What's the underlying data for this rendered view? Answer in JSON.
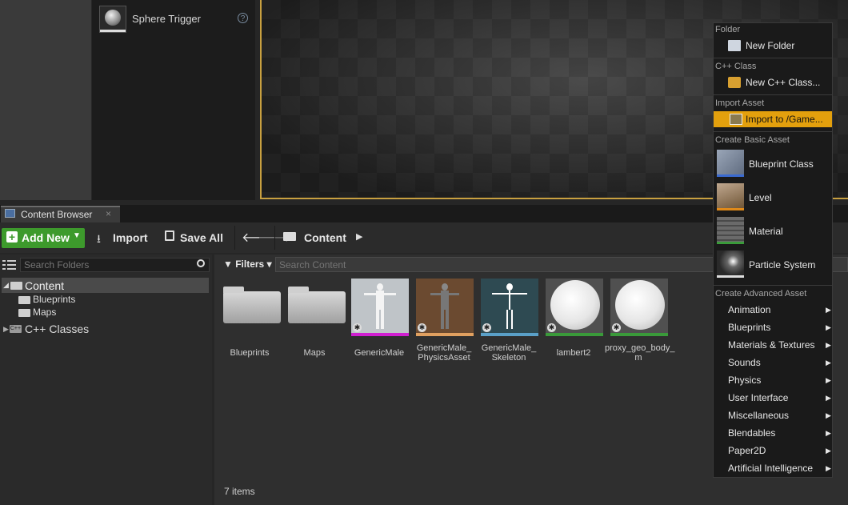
{
  "place_panel": {
    "item_label": "Sphere Trigger",
    "help_glyph": "?"
  },
  "tab": {
    "label": "Content Browser",
    "close_glyph": "×"
  },
  "toolbar": {
    "add_new": "Add New",
    "import": "Import",
    "save_all": "Save All",
    "path": "Content"
  },
  "folders": {
    "search_placeholder": "Search Folders",
    "tree": [
      {
        "label": "Content"
      },
      {
        "label": "Blueprints"
      },
      {
        "label": "Maps"
      },
      {
        "label": "C++ Classes"
      }
    ]
  },
  "assets": {
    "filters": "Filters",
    "search_placeholder": "Search Content",
    "items": [
      {
        "label": "Blueprints",
        "type": "folder"
      },
      {
        "label": "Maps",
        "type": "folder"
      },
      {
        "label": "GenericMale",
        "type": "skeletal-mesh",
        "color": "#d01fd0"
      },
      {
        "label": "GenericMale_\nPhysicsAsset",
        "type": "physics-asset",
        "color": "#e0a060"
      },
      {
        "label": "GenericMale_\nSkeleton",
        "type": "skeleton",
        "color": "#5aa0c8"
      },
      {
        "label": "lambert2",
        "type": "material",
        "color": "#3a9a3a"
      },
      {
        "label": "proxy_geo_body_\nm",
        "type": "material",
        "color": "#3a9a3a"
      }
    ],
    "count_text": "7 items"
  },
  "menu": {
    "folder_header": "Folder",
    "new_folder": "New Folder",
    "cpp_header": "C++ Class",
    "new_cpp": "New C++ Class...",
    "import_header": "Import Asset",
    "import_to": "Import to /Game...",
    "basic_header": "Create Basic Asset",
    "basic": [
      {
        "label": "Blueprint Class",
        "color": "#3a6ad0"
      },
      {
        "label": "Level",
        "color": "#e08a1a"
      },
      {
        "label": "Material",
        "color": "#3a9a3a"
      },
      {
        "label": "Particle System",
        "color": "#dddddd"
      }
    ],
    "advanced_header": "Create Advanced Asset",
    "advanced": [
      {
        "label": "Animation"
      },
      {
        "label": "Blueprints"
      },
      {
        "label": "Materials & Textures"
      },
      {
        "label": "Sounds"
      },
      {
        "label": "Physics"
      },
      {
        "label": "User Interface"
      },
      {
        "label": "Miscellaneous"
      },
      {
        "label": "Blendables"
      },
      {
        "label": "Paper2D"
      },
      {
        "label": "Artificial Intelligence"
      }
    ]
  }
}
